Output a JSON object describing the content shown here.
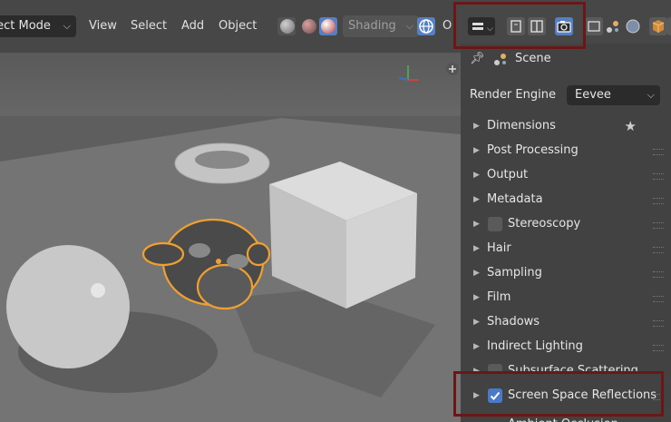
{
  "header": {
    "mode": "Object Mode",
    "menus": [
      "View",
      "Select",
      "Add",
      "Object"
    ],
    "shading_label": "Shading",
    "overlay_letter": "O"
  },
  "properties": {
    "scene_label": "Scene",
    "render_engine_label": "Render Engine",
    "render_engine_value": "Eevee",
    "sections": [
      {
        "label": "Dimensions"
      },
      {
        "label": "Post Processing"
      },
      {
        "label": "Output"
      },
      {
        "label": "Metadata"
      },
      {
        "label": "Stereoscopy",
        "checkbox": false
      },
      {
        "label": "Hair"
      },
      {
        "label": "Sampling"
      },
      {
        "label": "Film"
      },
      {
        "label": "Shadows"
      },
      {
        "label": "Indirect Lighting"
      },
      {
        "label": "Subsurface Scattering",
        "checkbox": false
      },
      {
        "label": "Screen Space Reflections",
        "checkbox": true
      },
      {
        "label": "Ambient Occlusion"
      }
    ]
  },
  "icons": {
    "editor_type": "properties-editor-icon",
    "tool_tab": "tool-settings-icon",
    "render_tab": "render-properties-icon",
    "pin": "pin-icon"
  },
  "colors": {
    "highlight": "#6b1717",
    "selection_outline": "#f0a030",
    "checkbox_on": "#4a7ac7"
  }
}
